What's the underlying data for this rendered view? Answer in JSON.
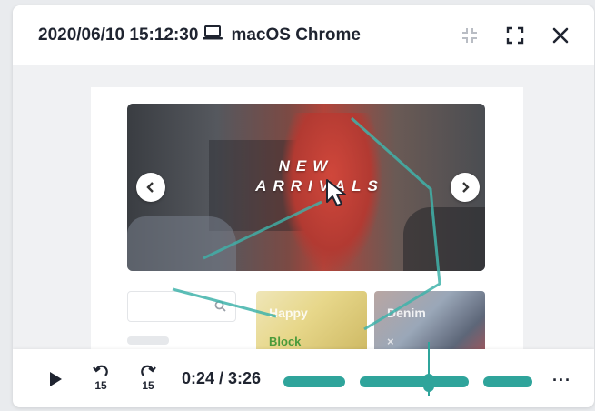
{
  "header": {
    "timestamp": "2020/06/10 15:12:30",
    "device": "macOS Chrome",
    "device_icon": "laptop-icon",
    "buttons": [
      "collapse-icon",
      "fullscreen-icon",
      "close-icon"
    ]
  },
  "recording": {
    "banner": {
      "line1": "NEW",
      "line2": "ARRIVALS"
    },
    "thumbs": [
      {
        "label": "Happy",
        "sub": "Block"
      },
      {
        "label": "Denim",
        "sub": "×"
      }
    ]
  },
  "player": {
    "time": "0:24 / 3:26",
    "rewind_label": "15",
    "forward_label": "15",
    "more": "···",
    "accent": "#2fa49b"
  }
}
